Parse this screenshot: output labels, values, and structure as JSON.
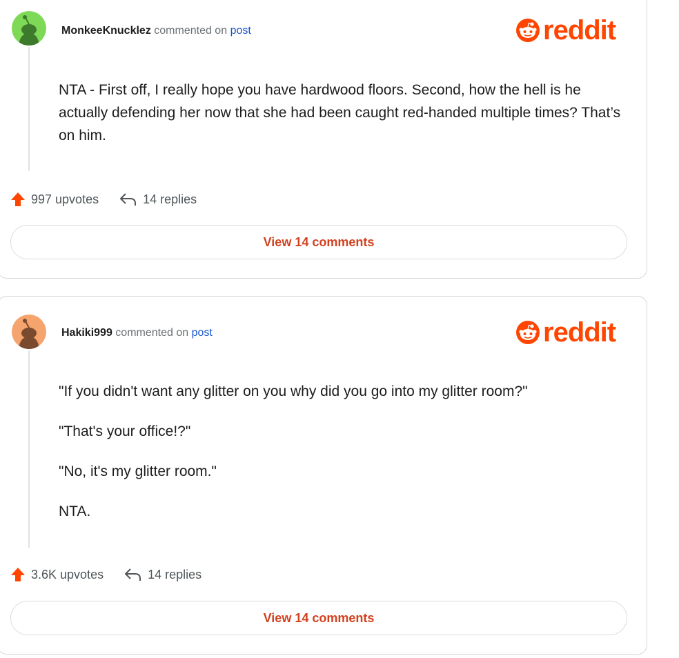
{
  "comments": [
    {
      "username": "MonkeeKnucklez",
      "action_text": "commented on",
      "post_link": "post",
      "logo_text": "reddit",
      "avatar_color": "#7ed957",
      "body": [
        "NTA - First off, I really hope you have hardwood floors. Second, how the hell is he actually defending her now that she had been caught red-handed multiple times? That’s on him."
      ],
      "upvotes": "997 upvotes",
      "replies": "14 replies",
      "view_button": "View 14 comments"
    },
    {
      "username": "Hakiki999",
      "action_text": "commented on",
      "post_link": "post",
      "logo_text": "reddit",
      "avatar_color": "#f4a46c",
      "body": [
        "\"If you didn't want any glitter on you why did you go into my glitter room?\"",
        "\"That's your office!?\"",
        "\"No, it's my glitter room.\"",
        "NTA."
      ],
      "upvotes": "3.6K upvotes",
      "replies": "14 replies",
      "view_button": "View 14 comments"
    }
  ],
  "colors": {
    "brand": "#ff4500",
    "link": "#1a56c9",
    "button_text": "#d2411f"
  },
  "icons": [
    "snoo-alien-avatar-icon",
    "reddit-snoo-logo-icon",
    "upvote-arrow-icon",
    "reply-arrow-icon"
  ]
}
